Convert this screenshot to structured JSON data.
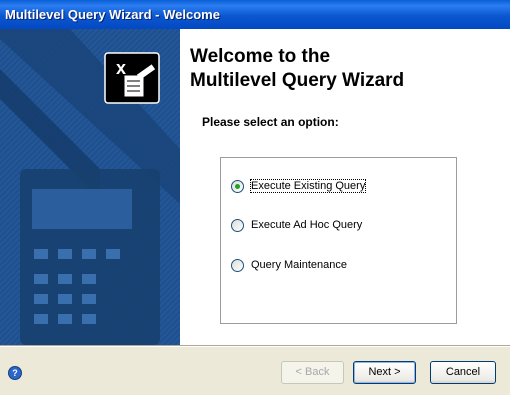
{
  "window": {
    "title": "Multilevel Query Wizard - Welcome"
  },
  "header": {
    "line1": "Welcome to the",
    "line2": "Multilevel Query Wizard"
  },
  "prompt": "Please select an option:",
  "options": [
    {
      "label": "Execute Existing Query",
      "selected": true
    },
    {
      "label": "Execute Ad Hoc Query",
      "selected": false
    },
    {
      "label": "Query Maintenance",
      "selected": false
    }
  ],
  "footer": {
    "back_label": "< Back",
    "next_label": "Next >",
    "cancel_label": "Cancel",
    "help_icon": "help-icon"
  },
  "colors": {
    "titlebar": "#0b57d0",
    "panel": "#1d4f8e",
    "radio_selected": "#21a121"
  }
}
